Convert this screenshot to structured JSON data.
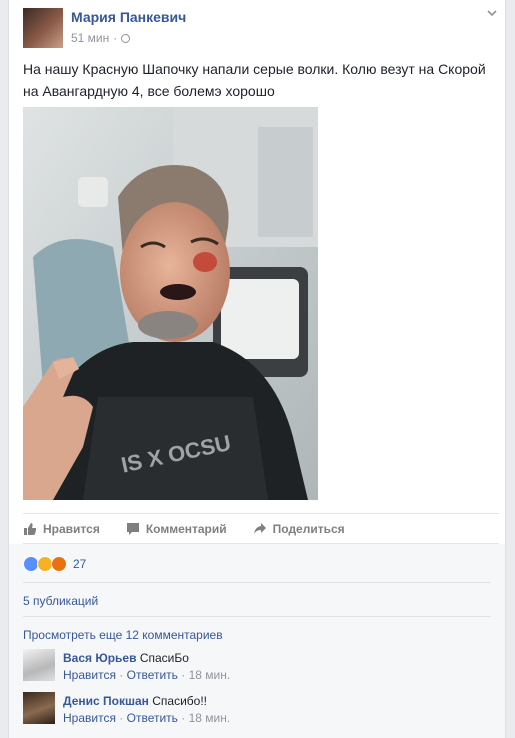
{
  "post": {
    "author": "Мария Панкевич",
    "time": "51 мин",
    "dot": "·",
    "text": "На нашу Красную Шапочку напали серые волки. Колю везут на Скорой на Авангардную 4, все болемэ хорошо",
    "photo_text": "IS X OCSU"
  },
  "actions": {
    "like": "Нравится",
    "comment": "Комментарий",
    "share": "Поделиться"
  },
  "reactions": {
    "icons": [
      "like-icon",
      "sad-icon",
      "angry-icon"
    ],
    "colors": [
      "#5890ff",
      "#f7b125",
      "#e9710f"
    ],
    "count": "27"
  },
  "shares": "5 публикаций",
  "more_comments": "Просмотреть еще 12 комментариев",
  "comments": [
    {
      "name": "Вася Юрьев",
      "text": "СпасиБо",
      "like": "Нравится",
      "reply": "Ответить",
      "dot": "·",
      "time": "18 мин."
    },
    {
      "name": "Денис Покшан",
      "text": "Спасибо!!",
      "like": "Нравится",
      "reply": "Ответить",
      "dot": "·",
      "time": "18 мин."
    }
  ],
  "colors": {
    "link": "#365899",
    "meta": "#90949c",
    "text": "#1d2129"
  }
}
